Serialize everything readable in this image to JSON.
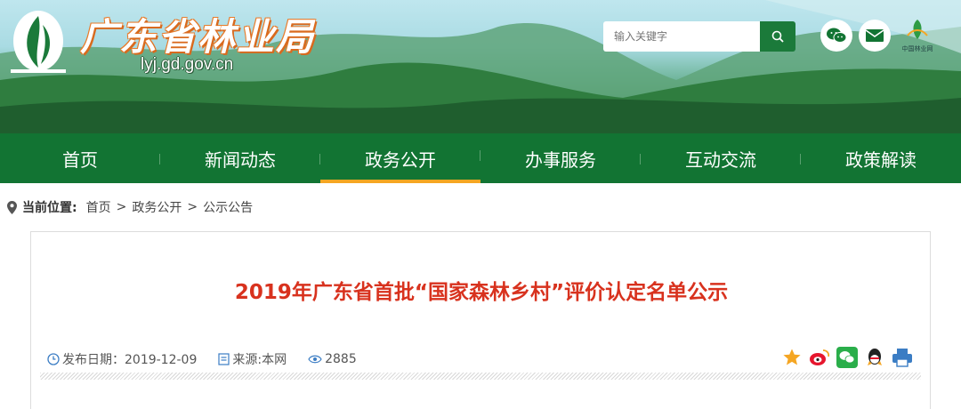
{
  "header": {
    "site_title": "广东省林业局",
    "site_url": "lyj.gd.gov.cn",
    "search_placeholder": "输入关键字",
    "badge_caption": "中国林业网",
    "colors": {
      "nav_green": "#127433",
      "active_orange": "#f5a623",
      "title_red": "#d8321e",
      "title_shadow": "#e87b2a"
    }
  },
  "nav": {
    "items": [
      {
        "label": "首页"
      },
      {
        "label": "新闻动态"
      },
      {
        "label": "政务公开",
        "active": true
      },
      {
        "label": "办事服务"
      },
      {
        "label": "互动交流"
      },
      {
        "label": "政策解读"
      }
    ]
  },
  "breadcrumb": {
    "label": "当前位置:",
    "items": [
      "首页",
      "政务公开",
      "公示公告"
    ],
    "sep": ">"
  },
  "article": {
    "title": "2019年广东省首批“国家森林乡村”评价认定名单公示",
    "publish_date": "发布日期：2019-12-09",
    "source": "来源:本网",
    "views": "2885"
  },
  "icons": [
    "location-pin-icon",
    "search-icon",
    "wechat-icon",
    "mail-icon",
    "forest-logo-icon",
    "clock-icon",
    "document-icon",
    "eye-icon",
    "favorite-star-icon",
    "weibo-icon",
    "qq-icon",
    "print-icon"
  ]
}
